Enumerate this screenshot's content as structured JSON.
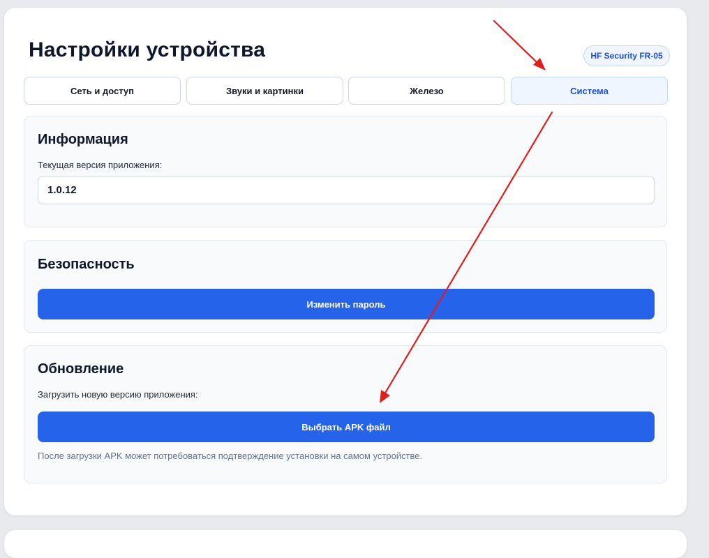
{
  "page": {
    "title": "Настройки устройства",
    "device_badge": "HF Security FR-05"
  },
  "tabs": [
    {
      "label": "Сеть и доступ",
      "active": false
    },
    {
      "label": "Звуки и картинки",
      "active": false
    },
    {
      "label": "Железо",
      "active": false
    },
    {
      "label": "Система",
      "active": true
    }
  ],
  "info": {
    "title": "Информация",
    "version_label": "Текущая версия приложения:",
    "version_value": "1.0.12"
  },
  "security": {
    "title": "Безопасность",
    "change_password_label": "Изменить пароль"
  },
  "update": {
    "title": "Обновление",
    "upload_label": "Загрузить новую версию приложения:",
    "choose_apk_label": "Выбрать APK файл",
    "hint": "После загрузки APK может потребоваться подтверждение установки на самом устройстве."
  },
  "colors": {
    "accent": "#2563eb",
    "annotation_arrow": "#e11d1d",
    "active_tab_bg": "#eff6ff",
    "page_bg": "#e9eaee"
  }
}
